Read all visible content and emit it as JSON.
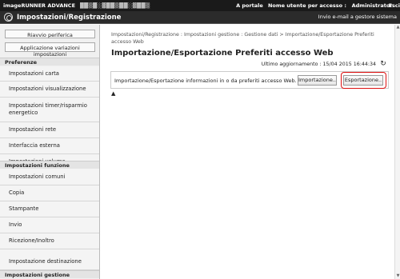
{
  "topbar": {
    "brand": "imageRUNNER ADVANCE",
    "device": "██▒█░▓██▒██░▓██▒",
    "portal": "A portale",
    "user_label": "Nome utente per accesso :",
    "user_name": "Administrator",
    "logout": "Esci"
  },
  "titlebar": {
    "title": "Impostazioni/Registrazione",
    "mail_link": "Invio e-mail a gestore sistema"
  },
  "sidebar": {
    "reboot_button": "Riavvio periferica",
    "apply_button": "Applicazione variazioni impostazioni",
    "categories": {
      "preferences": "Preferenze",
      "function_settings": "Impostazioni funzione",
      "management_settings": "Impostazioni gestione"
    },
    "items": [
      "Impostazioni carta",
      "Impostazioni visualizzazione",
      "Impostazioni timer/risparmio energetico",
      "Impostazioni rete",
      "Interfaccia esterna",
      "Impostazioni volume",
      "Impostazioni comuni",
      "Copia",
      "Stampante",
      "Invio",
      "Ricezione/Inoltro",
      "Memorizzazione/Accesso a file",
      "Impostazione destinazione"
    ]
  },
  "main": {
    "breadcrumb": "Impostazioni/Registrazione : Impostazioni gestione : Gestione dati > Importazione/Esportazione Preferiti accesso Web",
    "title": "Importazione/Esportazione Preferiti accesso Web",
    "last_update": "Ultimo aggiornamento : 15/04 2015 16:44:34",
    "description": "Importazione/Esportazione informazioni in o da preferiti accesso Web.",
    "import_button": "Importazione..",
    "export_button": "Esportazione..",
    "to_top": "▲"
  },
  "icons": {
    "logo": "canon-settings-logo-icon",
    "refresh": "refresh-icon",
    "to_top": "to-top-icon"
  },
  "colors": {
    "topbar": "#1a1a1a",
    "titlebar": "#2b2b2b",
    "highlight": "#dd1111"
  }
}
